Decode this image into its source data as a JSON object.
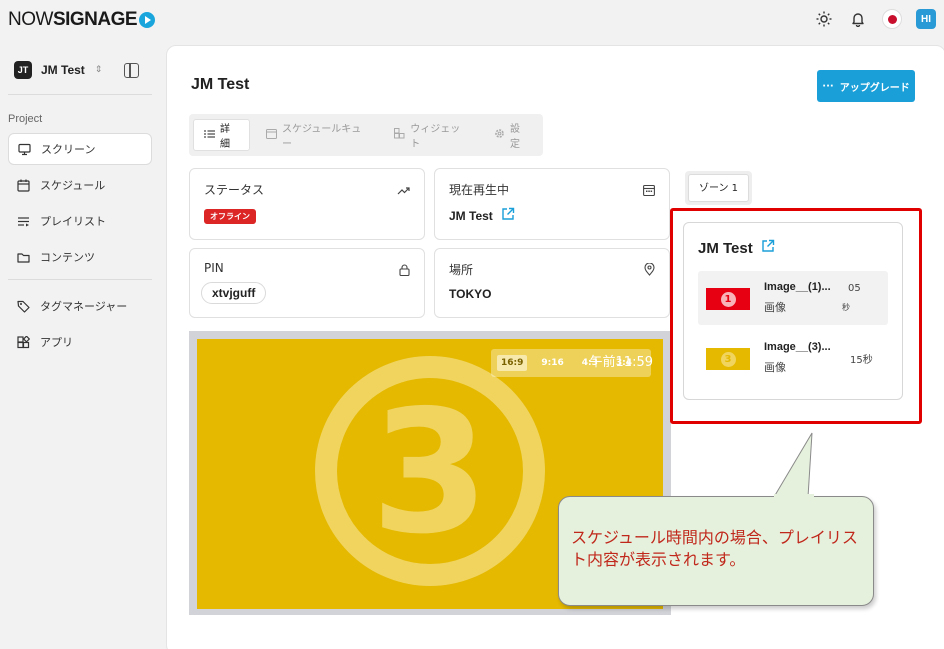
{
  "brand": {
    "part1": "NOW",
    "part2": "SIGNAGE"
  },
  "topbar": {
    "avatar": "HI"
  },
  "sidebar": {
    "project_initials": "JT",
    "project_name": "JM Test",
    "section_label": "Project",
    "items": [
      {
        "label": "スクリーン",
        "icon": "monitor-icon",
        "active": true
      },
      {
        "label": "スケジュール",
        "icon": "calendar-icon",
        "active": false
      },
      {
        "label": "プレイリスト",
        "icon": "playlist-icon",
        "active": false
      },
      {
        "label": "コンテンツ",
        "icon": "folder-icon",
        "active": false
      }
    ],
    "items2": [
      {
        "label": "タグマネージャー",
        "icon": "tag-icon"
      },
      {
        "label": "アプリ",
        "icon": "apps-icon"
      }
    ]
  },
  "page": {
    "title": "JM Test",
    "upgrade_label": "アップグレード"
  },
  "tabs": [
    {
      "label": "詳細",
      "active": true
    },
    {
      "label": "スケジュールキュー",
      "active": false
    },
    {
      "label": "ウィジェット",
      "active": false
    },
    {
      "label": "設定",
      "active": false
    }
  ],
  "cards": {
    "status": {
      "label": "ステータス",
      "badge": "オフライン"
    },
    "now_playing": {
      "label": "現在再生中",
      "value": "JM Test"
    },
    "pin": {
      "label": "PIN",
      "value": "xtvjguff"
    },
    "location": {
      "label": "場所",
      "value": "TOKYO"
    }
  },
  "preview": {
    "ratios": [
      "16:9",
      "9:16",
      "4:3",
      "3:4"
    ],
    "selected_ratio": "16:9",
    "time": "午前11:59",
    "big_number": "3",
    "bg_color": "#e5b900"
  },
  "zone": {
    "tab_label": "ゾーン 1",
    "title": "JM Test",
    "items": [
      {
        "name": "Image__(1)...",
        "type": "画像",
        "duration_num": "05",
        "duration_unit": "秒",
        "num": "1",
        "color": "#e60012"
      },
      {
        "name": "Image__(3)...",
        "type": "画像",
        "duration": "15秒",
        "num": "3",
        "color": "#e5b900"
      }
    ]
  },
  "callout": {
    "text": "スケジュール時間内の場合、プレイリスト内容が表示されます。"
  }
}
